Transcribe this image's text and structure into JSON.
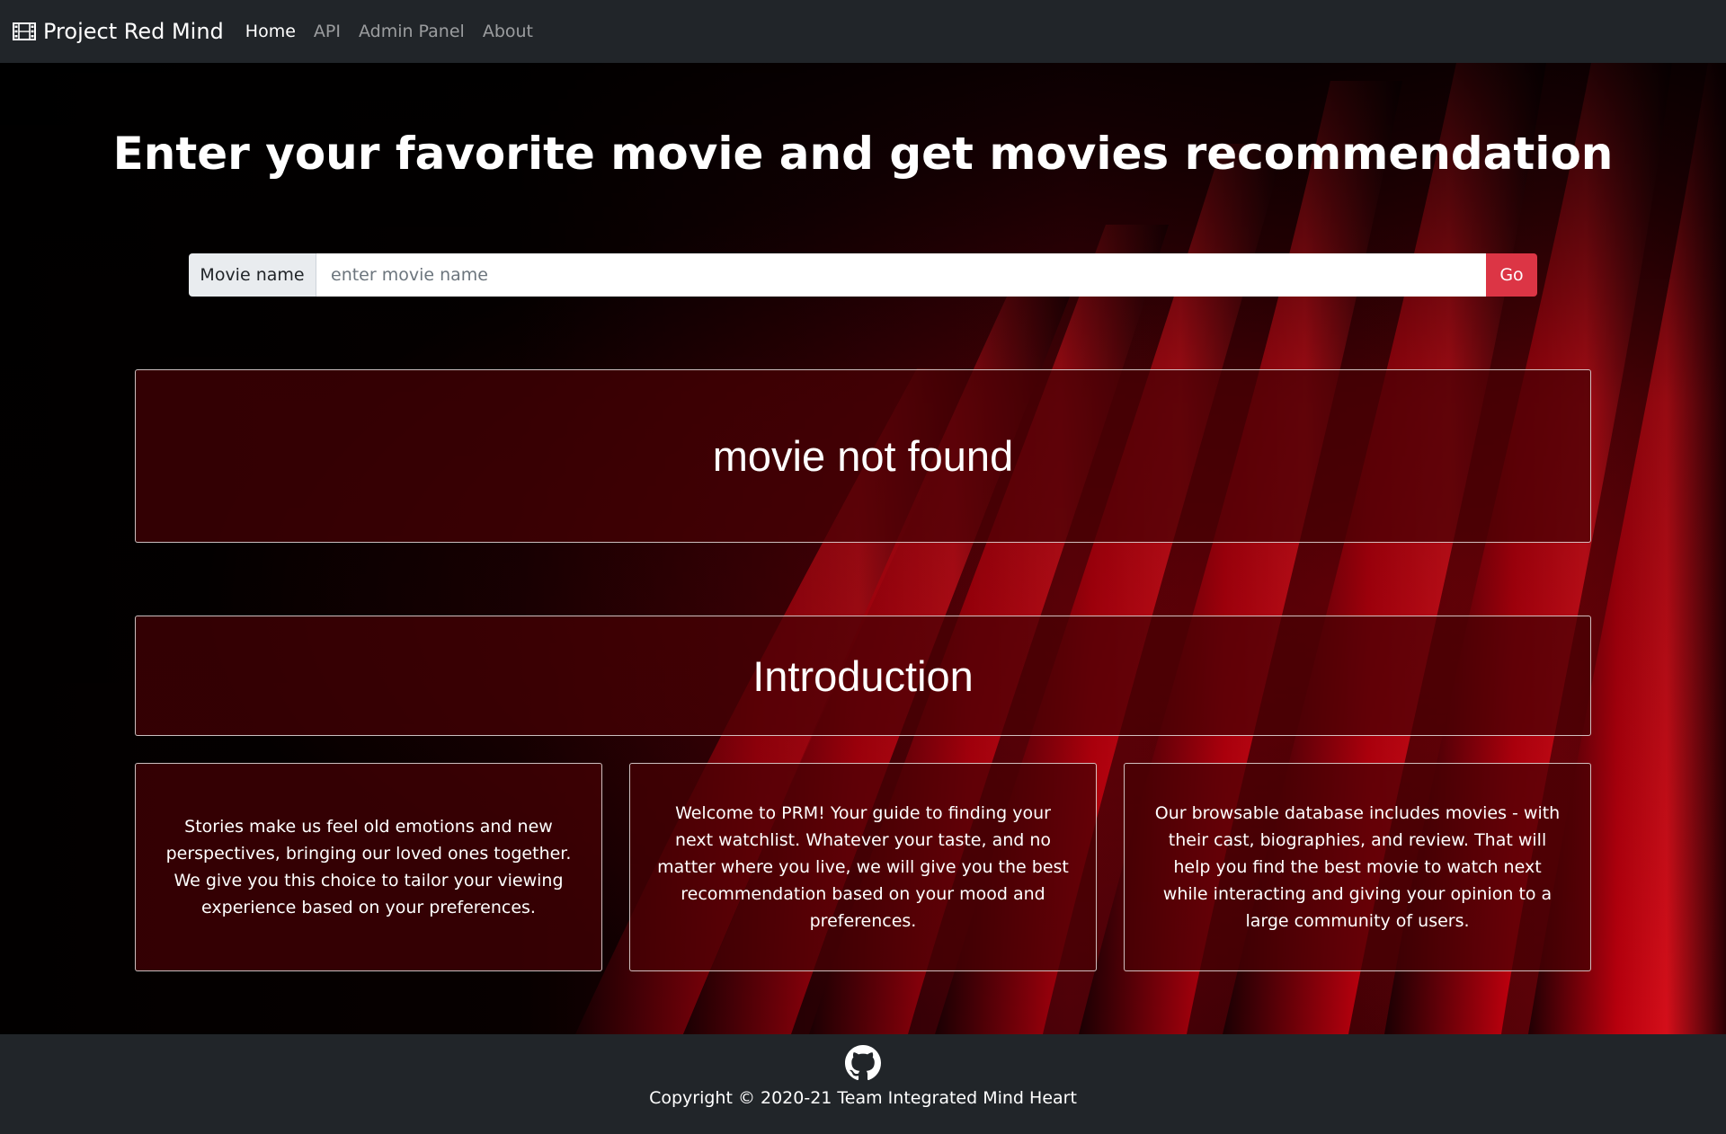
{
  "navbar": {
    "brand": "Project Red Mind",
    "brand_icon": "film-icon",
    "links": [
      {
        "label": "Home",
        "active": true
      },
      {
        "label": "API",
        "active": false
      },
      {
        "label": "Admin Panel",
        "active": false
      },
      {
        "label": "About",
        "active": false
      }
    ]
  },
  "hero": {
    "title": "Enter your favorite movie and get movies recommendation"
  },
  "search": {
    "label": "Movie name",
    "placeholder": "enter movie name",
    "value": "",
    "button_label": "Go",
    "button_color": "#dc3545"
  },
  "result": {
    "message": "movie not found"
  },
  "intro": {
    "title": "Introduction",
    "cards": [
      {
        "text": "Stories make us feel old emotions and new perspectives, bringing our loved ones together. We give you this choice to tailor your viewing experience based on your preferences."
      },
      {
        "text": "Welcome to PRM! Your guide to finding your next watchlist. Whatever your taste, and no matter where you live, we will give you the best recommendation based on your mood and preferences."
      },
      {
        "text": "Our browsable database includes movies - with their cast, biographies, and review. That will help you find the best movie to watch next while interacting and giving your opinion to a large community of users."
      }
    ]
  },
  "footer": {
    "icon": "github-icon",
    "copyright": "Copyright © 2020-21 Team Integrated Mind Heart"
  },
  "colors": {
    "navbar_bg": "#212529",
    "accent_red": "#dc3545",
    "curtain_red": "#b0000c"
  }
}
